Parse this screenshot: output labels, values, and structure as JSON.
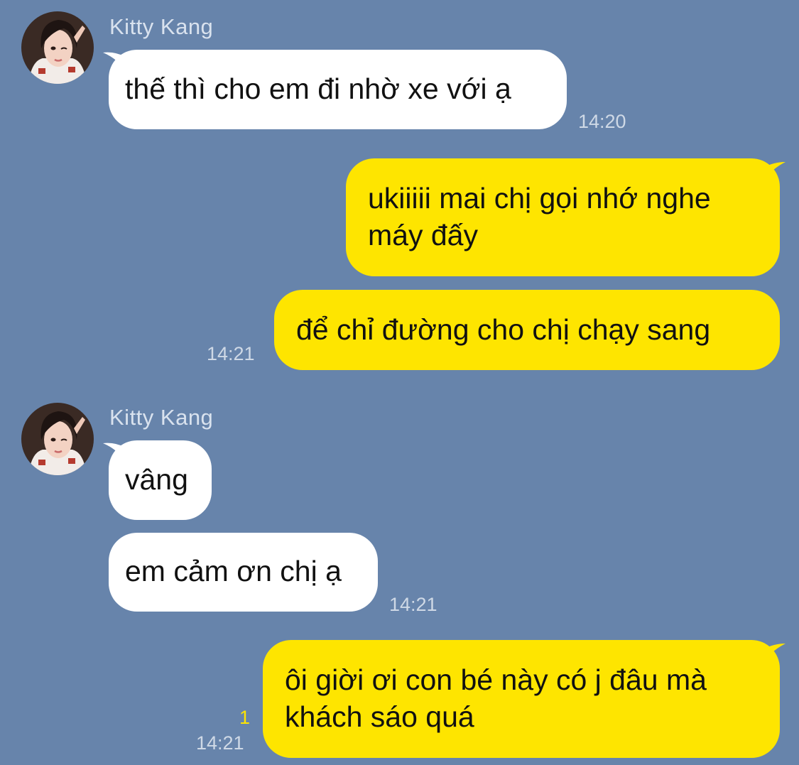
{
  "chat": {
    "groups": [
      {
        "sender": "Kitty Kang",
        "messages": [
          {
            "lines": [
              "thế thì cho em đi nhờ xe với ạ"
            ],
            "time": "14:20"
          }
        ]
      },
      {
        "sender": "me",
        "messages": [
          {
            "lines": [
              "ukiiiii mai chị gọi nhớ nghe",
              "máy đấy"
            ]
          },
          {
            "lines": [
              "để chỉ đường cho chị chạy sang"
            ],
            "time": "14:21"
          }
        ]
      },
      {
        "sender": "Kitty Kang",
        "messages": [
          {
            "lines": [
              "vâng"
            ]
          },
          {
            "lines": [
              "em cảm ơn chị ạ"
            ],
            "time": "14:21"
          }
        ]
      },
      {
        "sender": "me",
        "messages": [
          {
            "lines": [
              "ôi giời ơi con bé này có j đâu mà",
              "khách sáo quá"
            ],
            "time": "14:21",
            "unread": "1"
          }
        ]
      }
    ]
  },
  "colors": {
    "background": "#6784ab",
    "incoming_bubble": "#ffffff",
    "outgoing_bubble": "#fee500",
    "unread_count": "#fee500"
  },
  "icons": {
    "avatar": "profile-photo"
  }
}
